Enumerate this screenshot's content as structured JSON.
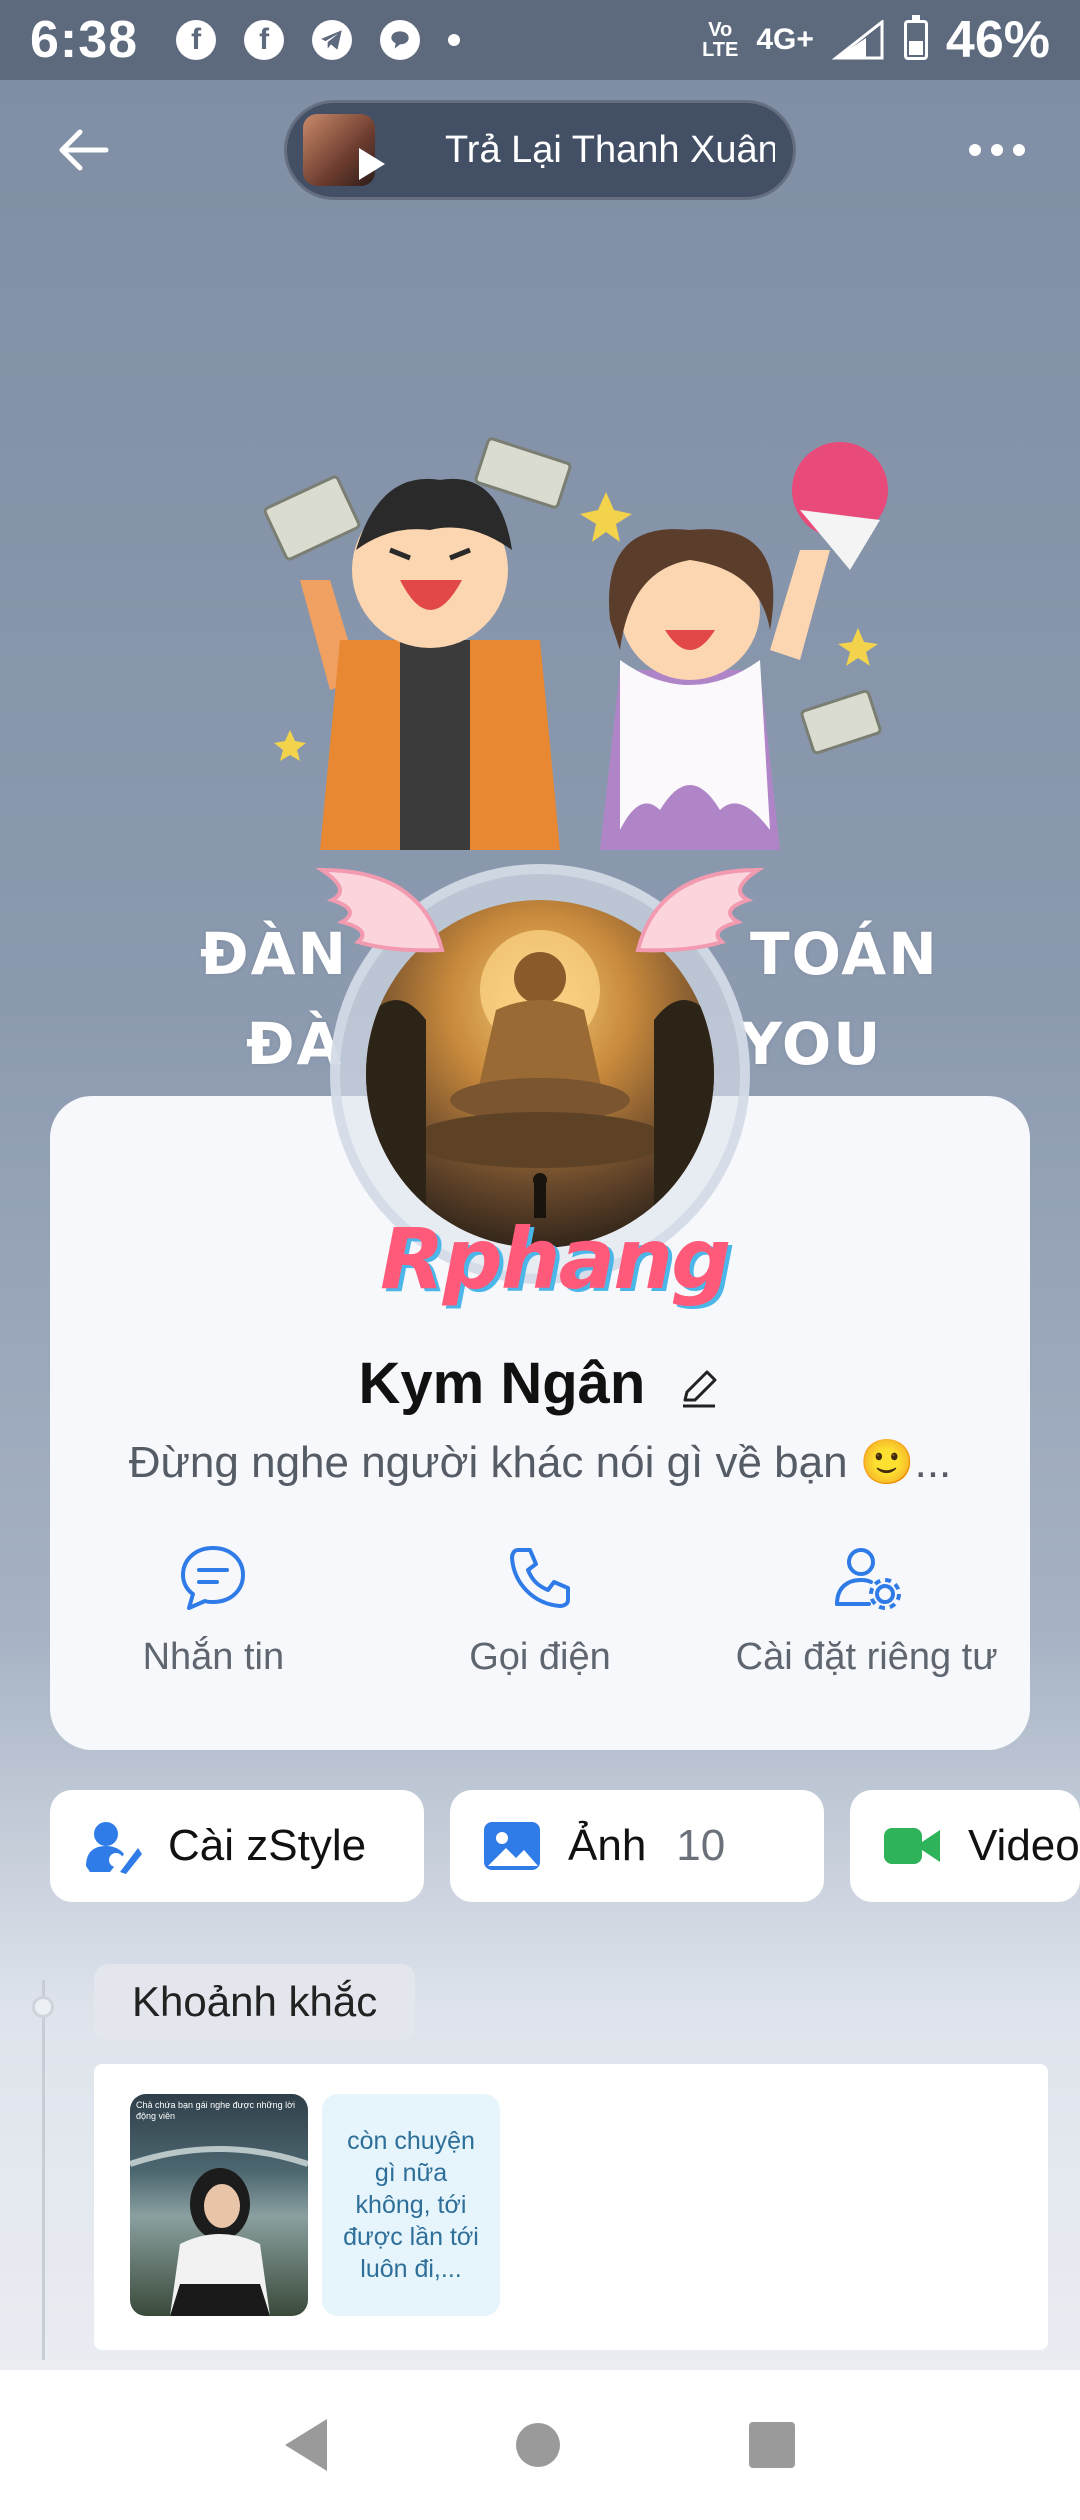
{
  "status_bar": {
    "time": "6:38",
    "network": "4G+",
    "volte_top": "Vo",
    "volte_bottom": "LTE",
    "battery": "46%"
  },
  "header": {
    "music_title": "Trả Lại Thanh Xuân"
  },
  "cover": {
    "line1_left": "ĐÀN",
    "line1_right": "TOÁN",
    "line2_left": "ĐÀ",
    "line2_right": "YOU"
  },
  "watermark": "Rphang",
  "profile": {
    "name": "Kym Ngân",
    "bio": "Đừng nghe người khác nói gì về bạn 🙂..."
  },
  "actions": [
    {
      "label": "Nhắn tin"
    },
    {
      "label": "Gọi điện"
    },
    {
      "label": "Cài đặt riêng tư"
    }
  ],
  "quick_buttons": [
    {
      "label": "Cài zStyle",
      "count": ""
    },
    {
      "label": "Ảnh",
      "count": "10"
    },
    {
      "label": "Video",
      "count": ""
    }
  ],
  "moments": {
    "title": "Khoảnh khắc",
    "photo_caption": "Chả chứa bạn gái nghe được những lời động viên",
    "text_item": "còn chuyện gì nữa không, tới được lần tới luôn đi,..."
  },
  "colors": {
    "accent_blue": "#2f7be8",
    "video_green": "#2fb35a",
    "watermark_pink": "#ff5a7a"
  }
}
